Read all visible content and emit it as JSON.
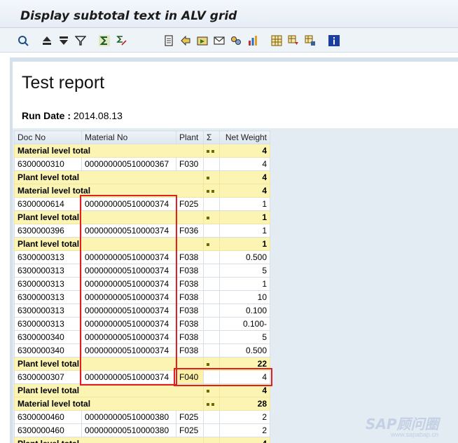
{
  "window": {
    "title": "Display subtotal text in ALV grid"
  },
  "toolbar": {
    "buttons": [
      {
        "name": "details-icon"
      },
      {
        "name": "sort-ascending-icon"
      },
      {
        "name": "sort-descending-icon"
      },
      {
        "name": "filter-icon"
      },
      {
        "name": "total-icon"
      },
      {
        "name": "subtotal-icon"
      },
      {
        "name": "print-preview-icon"
      },
      {
        "name": "export-icon"
      },
      {
        "name": "local-file-icon"
      },
      {
        "name": "mail-icon"
      },
      {
        "name": "abc-analysis-icon"
      },
      {
        "name": "graphic-icon"
      },
      {
        "name": "change-layout-icon"
      },
      {
        "name": "select-layout-icon"
      },
      {
        "name": "save-layout-icon"
      },
      {
        "name": "information-icon"
      }
    ]
  },
  "report": {
    "title": "Test report",
    "run_date_label": "Run Date :",
    "run_date_value": "2014.08.13"
  },
  "grid": {
    "columns": [
      "Doc No",
      "Material No",
      "Plant",
      "Σ",
      "Net Weight"
    ],
    "rows": [
      {
        "type": "total",
        "label": "Material level total",
        "dots": 2,
        "value": "4"
      },
      {
        "type": "data",
        "doc": "6300000310",
        "mat": "000000000510000367",
        "plant": "F030",
        "value": "4"
      },
      {
        "type": "total",
        "label": "Plant level total",
        "dots": 1,
        "value": "4"
      },
      {
        "type": "total",
        "label": "Material level total",
        "dots": 2,
        "value": "4"
      },
      {
        "type": "data",
        "doc": "6300000614",
        "mat": "000000000510000374",
        "plant": "F025",
        "value": "1"
      },
      {
        "type": "total",
        "label": "Plant level total",
        "dots": 1,
        "value": "1"
      },
      {
        "type": "data",
        "doc": "6300000396",
        "mat": "000000000510000374",
        "plant": "F036",
        "value": "1"
      },
      {
        "type": "total",
        "label": "Plant level total",
        "dots": 1,
        "value": "1"
      },
      {
        "type": "data",
        "doc": "6300000313",
        "mat": "000000000510000374",
        "plant": "F038",
        "value": "0.500"
      },
      {
        "type": "data",
        "doc": "6300000313",
        "mat": "000000000510000374",
        "plant": "F038",
        "value": "5"
      },
      {
        "type": "data",
        "doc": "6300000313",
        "mat": "000000000510000374",
        "plant": "F038",
        "value": "1"
      },
      {
        "type": "data",
        "doc": "6300000313",
        "mat": "000000000510000374",
        "plant": "F038",
        "value": "10"
      },
      {
        "type": "data",
        "doc": "6300000313",
        "mat": "000000000510000374",
        "plant": "F038",
        "value": "0.100"
      },
      {
        "type": "data",
        "doc": "6300000313",
        "mat": "000000000510000374",
        "plant": "F038",
        "value": "0.100-"
      },
      {
        "type": "data",
        "doc": "6300000340",
        "mat": "000000000510000374",
        "plant": "F038",
        "value": "5"
      },
      {
        "type": "data",
        "doc": "6300000340",
        "mat": "000000000510000374",
        "plant": "F038",
        "value": "0.500"
      },
      {
        "type": "total",
        "label": "Plant level total",
        "dots": 1,
        "value": "22"
      },
      {
        "type": "data",
        "doc": "6300000307",
        "mat": "000000000510000374",
        "plant": "F040",
        "value": "4",
        "selected_plant": true
      },
      {
        "type": "total",
        "label": "Plant level total",
        "dots": 1,
        "value": "4"
      },
      {
        "type": "total",
        "label": "Material level total",
        "dots": 2,
        "value": "28"
      },
      {
        "type": "data",
        "doc": "6300000460",
        "mat": "000000000510000380",
        "plant": "F025",
        "value": "2"
      },
      {
        "type": "data",
        "doc": "6300000460",
        "mat": "000000000510000380",
        "plant": "F025",
        "value": "2"
      },
      {
        "type": "total",
        "label": "Plant level total",
        "dots": 1,
        "value": "4"
      }
    ]
  },
  "watermark": {
    "brand": "SAP顾问圈",
    "url": "www.sapabap.cn"
  },
  "colors": {
    "total_row": "#fbf4b3",
    "highlight_frame": "#e0201f",
    "header_bg": "#dde6ef"
  }
}
